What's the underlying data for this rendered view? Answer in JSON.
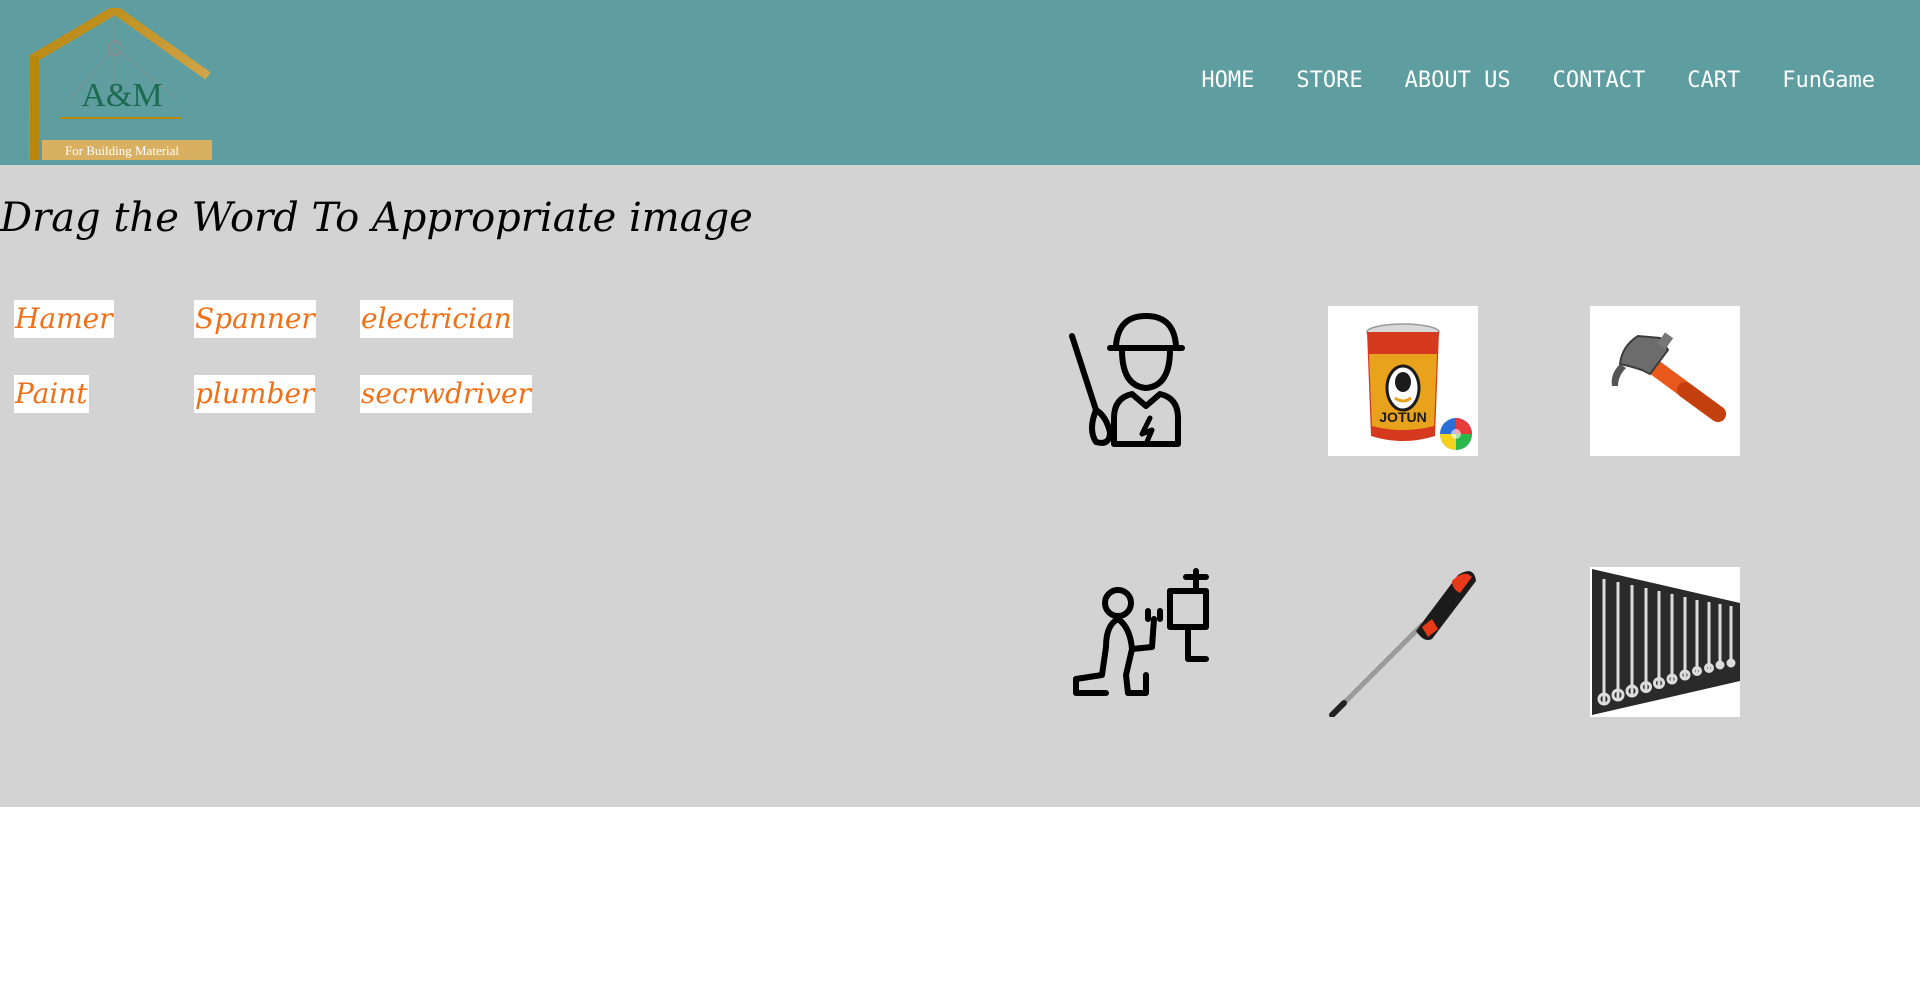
{
  "header": {
    "logo": {
      "brand": "A&M",
      "tagline": "For Building Material"
    },
    "nav": [
      "HOME",
      "STORE",
      "ABOUT US",
      "CONTACT",
      "CART",
      "FunGame"
    ]
  },
  "game": {
    "title": "Drag the Word To Appropriate image",
    "words": [
      "Hamer",
      "Spanner",
      "electrician",
      "Paint",
      "plumber",
      "secrwdriver"
    ],
    "images": [
      {
        "icon": "electrician-icon"
      },
      {
        "icon": "paint-bucket-image",
        "label": "JOTUN"
      },
      {
        "icon": "hammer-image"
      },
      {
        "icon": "plumber-icon"
      },
      {
        "icon": "screwdriver-image"
      },
      {
        "icon": "spanner-set-image"
      }
    ]
  },
  "colors": {
    "header_bg": "#5f9ea0",
    "game_bg": "#d3d3d3",
    "word_text": "#f07018",
    "nav_text": "#ffffff"
  }
}
